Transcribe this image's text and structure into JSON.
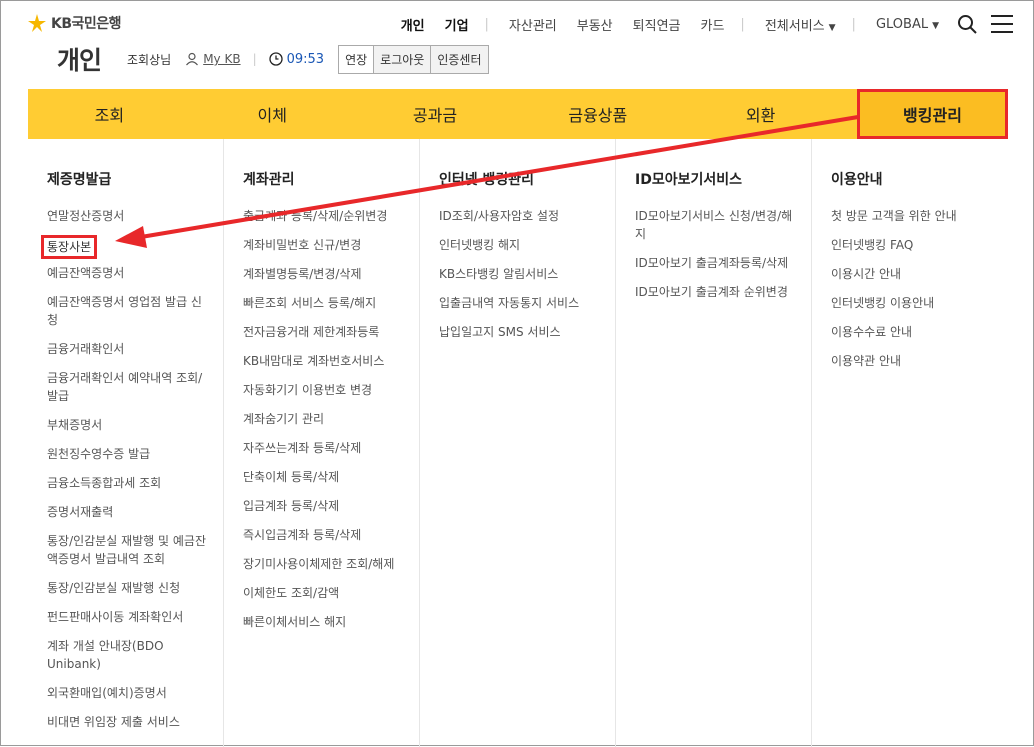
{
  "brand": {
    "name": "KB국민은행"
  },
  "topnav": {
    "personal": "개인",
    "corporate": "기업",
    "items": [
      "자산관리",
      "부동산",
      "퇴직연금",
      "카드"
    ],
    "all_services": "전체서비스",
    "global": "GLOBAL"
  },
  "subhead": {
    "title": "개인",
    "user": "조회상님",
    "mykb": "My KB",
    "time": "09:53",
    "extend": "연장",
    "logout": "로그아웃",
    "cert": "인증센터"
  },
  "gnb": [
    "조회",
    "이체",
    "공과금",
    "금융상품",
    "외환",
    "뱅킹관리"
  ],
  "columns": [
    {
      "head": "제증명발급",
      "items": [
        "연말정산증명서",
        "통장사본",
        "예금잔액증명서",
        "예금잔액증명서 영업점 발급 신청",
        "금융거래확인서",
        "금융거래확인서 예약내역 조회/발급",
        "부채증명서",
        "원천징수영수증 발급",
        "금융소득종합과세 조회",
        "증명서재출력",
        "통장/인감분실 재발행 및 예금잔액증명서 발급내역 조회",
        "통장/인감분실 재발행 신청",
        "펀드판매사이동 계좌확인서",
        "계좌 개설 안내장(BDO Unibank)",
        "외국환매입(예치)증명서",
        "비대면 위임장 제출 서비스"
      ]
    },
    {
      "head": "계좌관리",
      "items": [
        "출금계좌 등록/삭제/순위변경",
        "계좌비밀번호 신규/변경",
        "계좌별명등록/변경/삭제",
        "빠른조회 서비스 등록/해지",
        "전자금융거래 제한계좌등록",
        "KB내맘대로 계좌번호서비스",
        "자동화기기 이용번호 변경",
        "계좌숨기기 관리",
        "자주쓰는계좌 등록/삭제",
        "단축이체 등록/삭제",
        "입금계좌 등록/삭제",
        "즉시입금계좌 등록/삭제",
        "장기미사용이체제한 조회/해제",
        "이체한도 조회/감액",
        "빠른이체서비스 해지"
      ]
    },
    {
      "head": "인터넷 뱅킹관리",
      "items": [
        "ID조회/사용자암호 설정",
        "인터넷뱅킹 해지",
        "KB스타뱅킹 알림서비스",
        "입출금내역 자동통지 서비스",
        "납입일고지 SMS 서비스"
      ]
    },
    {
      "head": "ID모아보기서비스",
      "items": [
        "ID모아보기서비스 신청/변경/해지",
        "ID모아보기 출금계좌등록/삭제",
        "ID모아보기 출금계좌 순위변경"
      ]
    },
    {
      "head": "이용안내",
      "items": [
        "첫 방문 고객을 위한 안내",
        "인터넷뱅킹 FAQ",
        "이용시간 안내",
        "인터넷뱅킹 이용안내",
        "이용수수료 안내",
        "이용약관 안내"
      ]
    }
  ],
  "colors": {
    "gnb": "#ffcc33",
    "gnb_active": "#fbbd22",
    "highlight": "#e8282a",
    "timer": "#1a57b5"
  }
}
